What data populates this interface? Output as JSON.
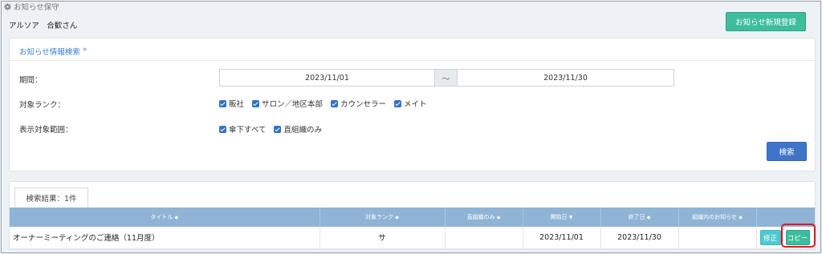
{
  "page": {
    "title": "お知らせ保守",
    "user_name": "アルソア　合歓さん",
    "register_button": "お知らせ新規登録"
  },
  "search": {
    "header": "お知らせ情報検索",
    "period_label": "期間：",
    "start_date": "2023/11/01",
    "separator": "〜",
    "end_date": "2023/11/30",
    "rank_label": "対象ランク：",
    "ranks": [
      "販社",
      "サロン／地区本部",
      "カウンセラー",
      "メイト"
    ],
    "scope_label": "表示対象範囲：",
    "scopes": [
      "傘下すべて",
      "直組織のみ"
    ],
    "search_button": "検索"
  },
  "results": {
    "tab_label": "検索結果：1件",
    "columns": [
      "タイトル",
      "対象ランク",
      "直組織のみ",
      "開始日",
      "終了日",
      "組織内のお知らせ"
    ],
    "rows": [
      {
        "title": "オーナーミーティングのご連絡（11月度）",
        "rank": "サ",
        "direct_only": "",
        "start": "2023/11/01",
        "end": "2023/11/30",
        "internal": ""
      }
    ],
    "edit_button": "修正",
    "copy_button": "コピー"
  },
  "colors": {
    "accent_green": "#3dbd9d",
    "search_blue": "#3f74c8",
    "table_header": "#8fb4d6",
    "highlight_red": "#e3161c"
  }
}
